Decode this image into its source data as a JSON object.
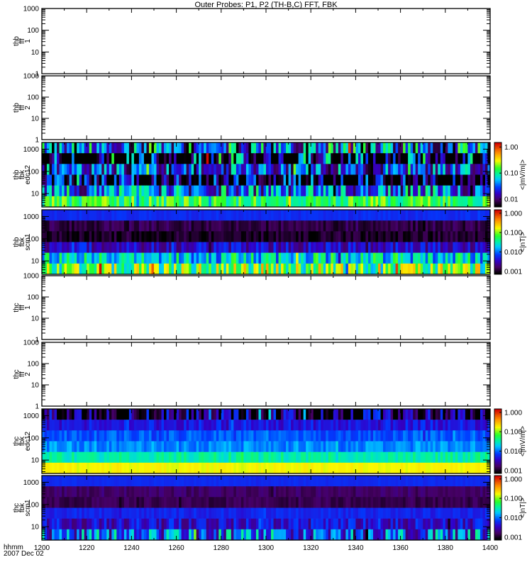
{
  "chart_data": {
    "type": "heatmap",
    "title": "Outer Probes: P1, P2 (TH-B,C) FFT, FBK",
    "x_axis": {
      "label_lines": [
        "hhmm",
        "2007 Dec 02"
      ],
      "range": [
        1200,
        1400
      ],
      "tick_labels": [
        "1200",
        "1220",
        "1240",
        "1260",
        "1280",
        "1300",
        "1320",
        "1340",
        "1360",
        "1380",
        "1400"
      ],
      "major_step": 20,
      "minor_step": 10
    },
    "panels": [
      {
        "ylabel": [
          "thb",
          "fff",
          "1"
        ],
        "ylim": [
          1,
          1000
        ],
        "yticks": [
          "1",
          "10",
          "100",
          "1000"
        ],
        "empty": true
      },
      {
        "ylabel": [
          "thb",
          "fff",
          "2"
        ],
        "ylim": [
          1,
          1000
        ],
        "yticks": [
          "1",
          "10",
          "100",
          "1000"
        ],
        "empty": true
      },
      {
        "ylabel": [
          "thb",
          "fbk",
          "edc12"
        ],
        "ylim": [
          2.5,
          2000
        ],
        "yticks": [
          "10",
          "100",
          "1000"
        ],
        "empty": false,
        "colorbar": {
          "unit": "<|mV/m|>",
          "range": [
            0.005,
            1.5
          ],
          "ticks": [
            "1.00",
            "0.10",
            "0.01"
          ]
        },
        "bands": [
          {
            "level": 0.3,
            "var": 0.35,
            "seed": 11
          },
          {
            "level": 0.04,
            "var": 0.55,
            "seed": 12
          },
          {
            "level": 0.27,
            "var": 0.25,
            "seed": 13
          },
          {
            "level": 0.06,
            "var": 0.35,
            "seed": 14
          },
          {
            "level": 0.33,
            "var": 0.25,
            "seed": 15
          },
          {
            "level": 0.58,
            "var": 0.12,
            "seed": 16
          }
        ]
      },
      {
        "ylabel": [
          "thb",
          "fbk",
          "scm1"
        ],
        "ylim": [
          2.5,
          2000
        ],
        "yticks": [
          "10",
          "100",
          "1000"
        ],
        "empty": false,
        "colorbar": {
          "unit": "<|nT|>",
          "range": [
            0.0007,
            1.5
          ],
          "ticks": [
            "1.000",
            "0.100",
            "0.010",
            "0.001"
          ]
        },
        "bands": [
          {
            "level": 0.27,
            "var": 0.02,
            "seed": 21
          },
          {
            "level": 0.07,
            "var": 0.05,
            "seed": 22
          },
          {
            "level": 0.04,
            "var": 0.05,
            "seed": 23
          },
          {
            "level": 0.2,
            "var": 0.1,
            "seed": 24
          },
          {
            "level": 0.45,
            "var": 0.18,
            "seed": 25
          },
          {
            "level": 0.62,
            "var": 0.22,
            "seed": 26
          }
        ]
      },
      {
        "ylabel": [
          "thc",
          "fff",
          "1"
        ],
        "ylim": [
          1,
          1000
        ],
        "yticks": [
          "1",
          "10",
          "100",
          "1000"
        ],
        "empty": true
      },
      {
        "ylabel": [
          "thc",
          "fff",
          "2"
        ],
        "ylim": [
          1,
          1000
        ],
        "yticks": [
          "1",
          "10",
          "100",
          "1000"
        ],
        "empty": true
      },
      {
        "ylabel": [
          "thc",
          "fbk",
          "edc12"
        ],
        "ylim": [
          2.5,
          2000
        ],
        "yticks": [
          "10",
          "100",
          "1000"
        ],
        "empty": false,
        "colorbar": {
          "unit": "<|mV/m|>",
          "range": [
            0.0007,
            1.5
          ],
          "ticks": [
            "1.000",
            "0.100",
            "0.010",
            "0.001"
          ]
        },
        "bands": [
          {
            "level": 0.06,
            "var": 0.25,
            "seed": 31
          },
          {
            "level": 0.24,
            "var": 0.06,
            "seed": 32
          },
          {
            "level": 0.32,
            "var": 0.05,
            "seed": 33
          },
          {
            "level": 0.37,
            "var": 0.05,
            "seed": 34
          },
          {
            "level": 0.5,
            "var": 0.05,
            "seed": 35
          },
          {
            "level": 0.72,
            "var": 0.02,
            "seed": 36
          }
        ]
      },
      {
        "ylabel": [
          "thc",
          "fbk",
          "scm1"
        ],
        "ylim": [
          2.5,
          2000
        ],
        "yticks": [
          "10",
          "100",
          "1000"
        ],
        "empty": false,
        "colorbar": {
          "unit": "<|nT|>",
          "range": [
            0.0007,
            1.5
          ],
          "ticks": [
            "1.000",
            "0.100",
            "0.010",
            "0.001"
          ]
        },
        "bands": [
          {
            "level": 0.27,
            "var": 0.01,
            "seed": 41
          },
          {
            "level": 0.1,
            "var": 0.03,
            "seed": 42
          },
          {
            "level": 0.08,
            "var": 0.03,
            "seed": 43
          },
          {
            "level": 0.26,
            "var": 0.03,
            "seed": 44
          },
          {
            "level": 0.21,
            "var": 0.1,
            "seed": 45
          },
          {
            "level": 0.32,
            "var": 0.22,
            "seed": 46
          }
        ]
      }
    ]
  }
}
